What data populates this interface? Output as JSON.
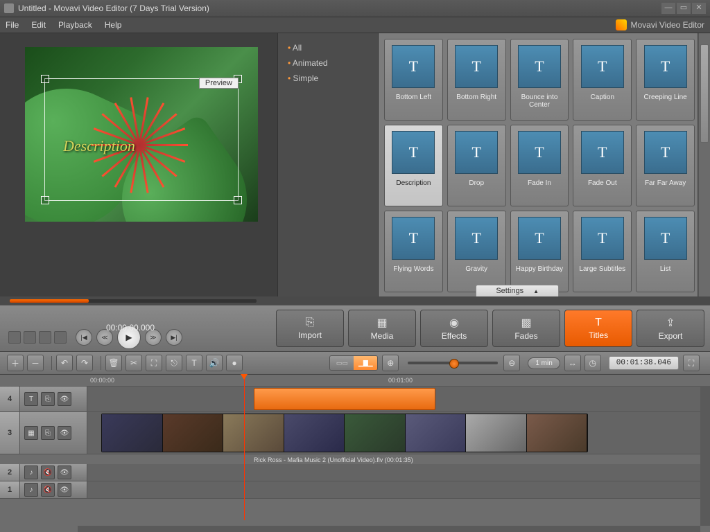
{
  "window": {
    "title": "Untitled - Movavi Video Editor (7 Days Trial Version)"
  },
  "menu": {
    "file": "File",
    "edit": "Edit",
    "playback": "Playback",
    "help": "Help",
    "brand": "Movavi Video Editor"
  },
  "categories": {
    "all": "All",
    "animated": "Animated",
    "simple": "Simple"
  },
  "preview": {
    "badge": "Preview",
    "overlay": "Description"
  },
  "titles": [
    "Bottom Left",
    "Bottom Right",
    "Bounce into Center",
    "Caption",
    "Creeping Line",
    "Description",
    "Drop",
    "Fade In",
    "Fade Out",
    "Far Far Away",
    "Flying Words",
    "Gravity",
    "Happy Birthday",
    "Large Subtitles",
    "List"
  ],
  "settings_tab": "Settings",
  "playback": {
    "time": "00:00:00.000"
  },
  "modes": {
    "import": "Import",
    "media": "Media",
    "effects": "Effects",
    "fades": "Fades",
    "titles": "Titles",
    "export": "Export"
  },
  "toolbar": {
    "timeline_unit": "1 min",
    "timecode": "00:01:38.046"
  },
  "ruler": {
    "t0": "00:00:00",
    "t1": "00:01:00"
  },
  "tracks": {
    "n4": "4",
    "n3": "3",
    "n2": "2",
    "n1": "1"
  },
  "clip": {
    "caption": "Rick Ross - Mafia Music 2 (Unofficial Video).flv (00:01:35)"
  }
}
